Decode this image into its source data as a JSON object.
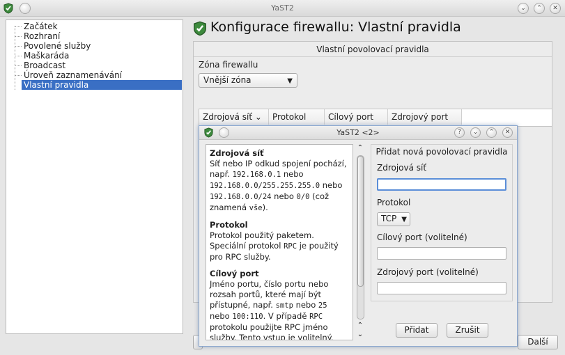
{
  "window": {
    "title": "YaST2"
  },
  "sidebar": {
    "items": [
      {
        "label": "Začátek"
      },
      {
        "label": "Rozhraní"
      },
      {
        "label": "Povolené služby"
      },
      {
        "label": "Maškaráda"
      },
      {
        "label": "Broadcast"
      },
      {
        "label": "Úroveň zaznamenávání"
      },
      {
        "label": "Vlastní pravidla"
      }
    ]
  },
  "main": {
    "heading": "Konfigurace firewallu: Vlastní pravidla",
    "panel_title": "Vlastní povolovací pravidla",
    "zone_label": "Zóna firewallu",
    "zone_value": "Vnější zóna",
    "columns": [
      "Zdrojová síť",
      "Protokol",
      "Cílový port",
      "Zdrojový port"
    ],
    "next_label": "Další"
  },
  "dialog": {
    "title": "YaST2 <2>",
    "help": {
      "src_head": "Zdrojová síť",
      "src_1": "Síť nebo IP odkud spojení pochází, např.",
      "src_ip1": "192.168.0.1",
      "src_or1": "nebo",
      "src_ip2": "192.168.0.0/255.255.255.0",
      "src_or2": "nebo",
      "src_ip3": "192.168.0.0/24",
      "src_or3": "nebo",
      "src_ip4": "0/0",
      "src_2": "(což znamená",
      "src_all": "vše",
      "src_3": ").",
      "proto_head": "Protokol",
      "proto_1": "Protokol použitý paketem. Speciální protokol",
      "proto_rpc": "RPC",
      "proto_2": "je použitý pro RPC služby.",
      "port_head": "Cílový port",
      "port_1": "Jméno portu, číslo portu nebo rozsah portů, které mají být přístupné, např.",
      "port_smtp": "smtp",
      "port_or1": "nebo",
      "port_25": "25",
      "port_or2": "nebo",
      "port_range": "100:110",
      "port_2": ". V případě",
      "port_rpc": "RPC",
      "port_3": "protokolu použijte RPC jméno služby. Tento vstup je volitelný."
    },
    "form": {
      "group_title": "Přidat nová povolovací pravidla",
      "src_label": "Zdrojová síť",
      "src_value": "",
      "proto_label": "Protokol",
      "proto_value": "TCP",
      "dst_label": "Cílový port (volitelné)",
      "dst_value": "",
      "sport_label": "Zdrojový port (volitelné)",
      "sport_value": ""
    },
    "add_label": "Přidat",
    "cancel_label": "Zrušit"
  }
}
